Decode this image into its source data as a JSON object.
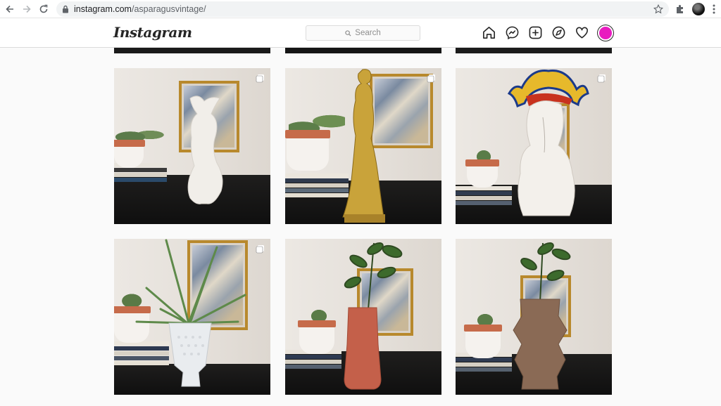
{
  "browser": {
    "url_domain": "instagram.com",
    "url_path": "/asparagusvintage/",
    "icons": [
      "back-arrow-icon",
      "forward-arrow-icon",
      "reload-icon",
      "lock-icon",
      "star-icon",
      "puzzle-icon",
      "kebab-menu-icon"
    ]
  },
  "header": {
    "logo_text": "Instagram",
    "search_placeholder": "Search",
    "nav_icons": [
      "home-icon",
      "messenger-icon",
      "new-post-icon",
      "explore-icon",
      "heart-icon",
      "profile-avatar"
    ],
    "avatar_color": "#e81cbf"
  },
  "grid": {
    "rows": [
      {
        "tiles": [
          {
            "subject": "white kneeling figure statue",
            "multi": true
          },
          {
            "subject": "gold standing figure statue",
            "multi": true
          },
          {
            "subject": "white couple sculpture with jester hat",
            "multi": true
          }
        ]
      },
      {
        "tiles": [
          {
            "subject": "aloe in white milk glass planter",
            "multi": true
          },
          {
            "subject": "terracotta vase with greenery",
            "multi": false
          },
          {
            "subject": "brown stacked vase with greenery",
            "multi": false
          }
        ]
      }
    ]
  }
}
